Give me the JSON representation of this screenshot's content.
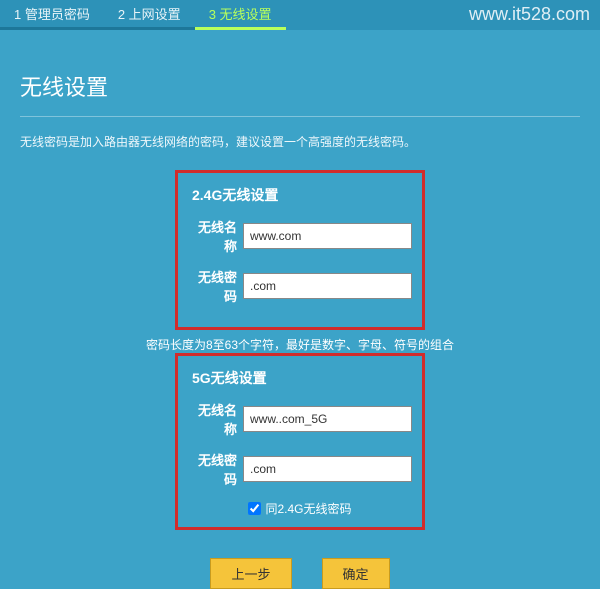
{
  "watermark": "www.it528.com",
  "steps": [
    {
      "label": "1 管理员密码"
    },
    {
      "label": "2 上网设置"
    },
    {
      "label": "3 无线设置"
    }
  ],
  "page": {
    "title": "无线设置",
    "desc": "无线密码是加入路由器无线网络的密码，建议设置一个高强度的无线密码。"
  },
  "panel24": {
    "title": "2.4G无线设置",
    "name_label": "无线名称",
    "name_value": "www.com",
    "pwd_label": "无线密码",
    "pwd_value": ".com",
    "hint": "密码长度为8至63个字符，最好是数字、字母、符号的组合"
  },
  "panel5": {
    "title": "5G无线设置",
    "name_label": "无线名称",
    "name_value": "www..com_5G",
    "pwd_label": "无线密码",
    "pwd_value": ".com",
    "same_label": "同2.4G无线密码"
  },
  "buttons": {
    "prev": "上一步",
    "ok": "确定"
  }
}
